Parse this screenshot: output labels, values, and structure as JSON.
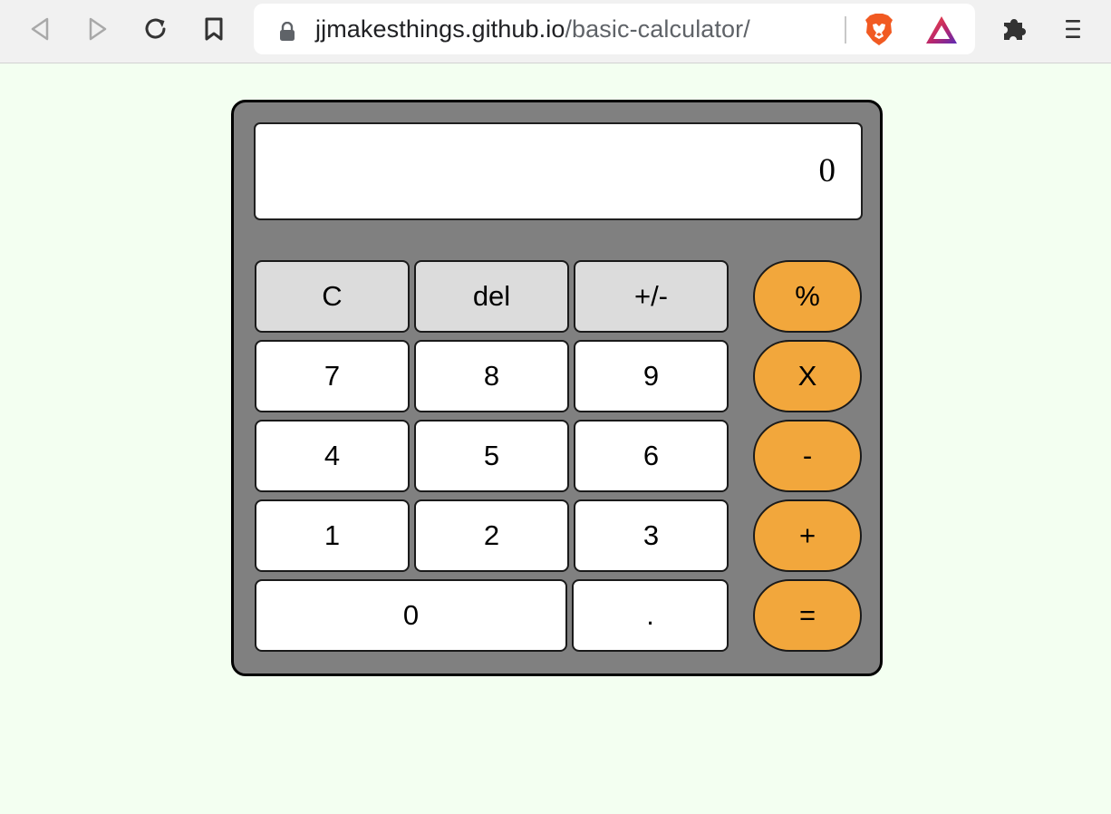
{
  "browser": {
    "url_host": "jjmakesthings.github.io",
    "url_path": "/basic-calculator/"
  },
  "calculator": {
    "display_value": "0",
    "function_keys": [
      "C",
      "del",
      "+/-"
    ],
    "digit_rows": [
      [
        "7",
        "8",
        "9"
      ],
      [
        "4",
        "5",
        "6"
      ],
      [
        "1",
        "2",
        "3"
      ]
    ],
    "bottom_row": [
      "0",
      "."
    ],
    "operator_keys": [
      "%",
      "X",
      "-",
      "+",
      "="
    ]
  },
  "colors": {
    "page_background": "#f3fff1",
    "calculator_body": "#808080",
    "operator": "#f2a73c",
    "function_key": "#dcdcdc"
  }
}
